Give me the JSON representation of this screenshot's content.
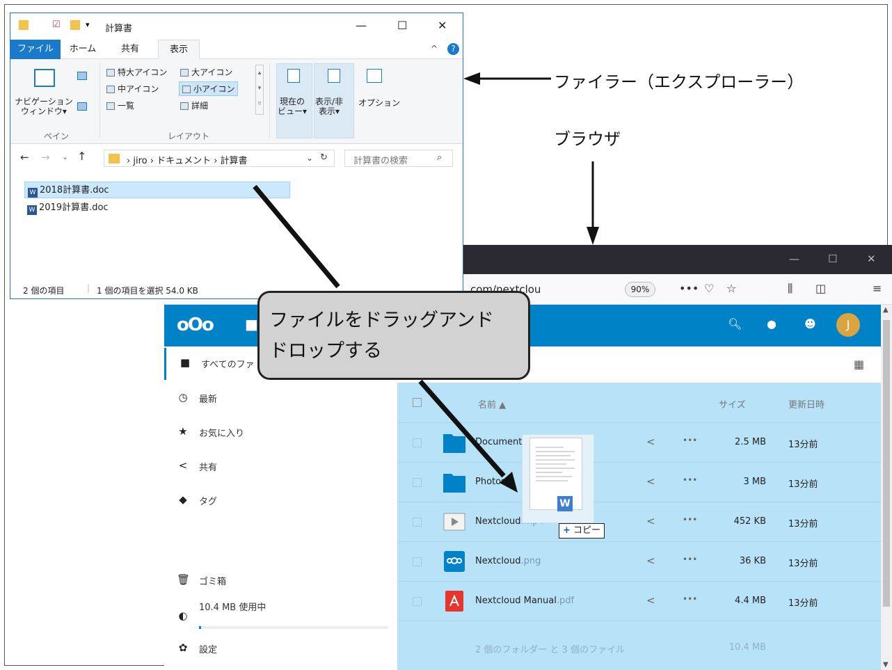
{
  "explorer": {
    "title": "計算書",
    "tabs": [
      "ファイル",
      "ホーム",
      "共有",
      "表示"
    ],
    "ribbon": {
      "nav_pane": "ナビゲーション\nウィンドウ▾",
      "pane_group": "ペイン",
      "layout_group": "レイアウト",
      "extra_large_icons": "特大アイコン",
      "large_icons": "大アイコン",
      "medium_icons": "中アイコン",
      "small_icons": "小アイコン",
      "list": "一覧",
      "details": "詳細",
      "current_view": "現在の\nビュー▾",
      "show_hide": "表示/非\n表示▾",
      "options": "オプション"
    },
    "breadcrumb": [
      "jiro",
      "ドキュメント",
      "計算書"
    ],
    "search_placeholder": "計算書の検索",
    "files": [
      "2018計算書.doc",
      "2019計算書.doc"
    ],
    "status_count": "2 個の項目",
    "status_selected": "1 個の項目を選択 54.0 KB"
  },
  "browser": {
    "url": "com/nextclou",
    "zoom": "90%",
    "user_initial": "J",
    "sidebar": [
      {
        "icon": "folder-icon",
        "label": "すべてのファ"
      },
      {
        "icon": "clock-icon",
        "label": "最新"
      },
      {
        "icon": "star-icon",
        "label": "お気に入り"
      },
      {
        "icon": "share-icon",
        "label": "共有"
      },
      {
        "icon": "tag-icon",
        "label": "タグ"
      }
    ],
    "trash": "ゴミ箱",
    "quota": "10.4 MB 使用中",
    "quota_fraction": 0.01,
    "settings": "設定",
    "columns": {
      "name": "名前 ▲",
      "size": "サイズ",
      "modified": "更新日時"
    },
    "files": [
      {
        "type": "folder",
        "name": "Documents",
        "ext": "",
        "size": "2.5 MB",
        "date": "13分前"
      },
      {
        "type": "folder",
        "name": "Photos",
        "ext": "",
        "size": "3 MB",
        "date": "13分前"
      },
      {
        "type": "video",
        "name": "Nextcloud",
        "ext": ".mp4",
        "size": "452 KB",
        "date": "13分前"
      },
      {
        "type": "image",
        "name": "Nextcloud",
        "ext": ".png",
        "size": "36 KB",
        "date": "13分前"
      },
      {
        "type": "pdf",
        "name": "Nextcloud Manual",
        "ext": ".pdf",
        "size": "4.4 MB",
        "date": "13分前"
      }
    ],
    "summary": "2 個のフォルダー と 3 個のファイル",
    "summary_size": "10.4 MB",
    "copy_badge": "コピー",
    "copy_plus": "+"
  },
  "annotations": {
    "filer": "ファイラー（エクスプローラー）",
    "browser": "ブラウザ",
    "bubble": "ファイルをドラッグアンド\nドロップする"
  },
  "colors": {
    "nextcloud_blue": "#0082c9",
    "explorer_file_tab": "#1979ca",
    "list_bg": "#b8e2f8"
  }
}
